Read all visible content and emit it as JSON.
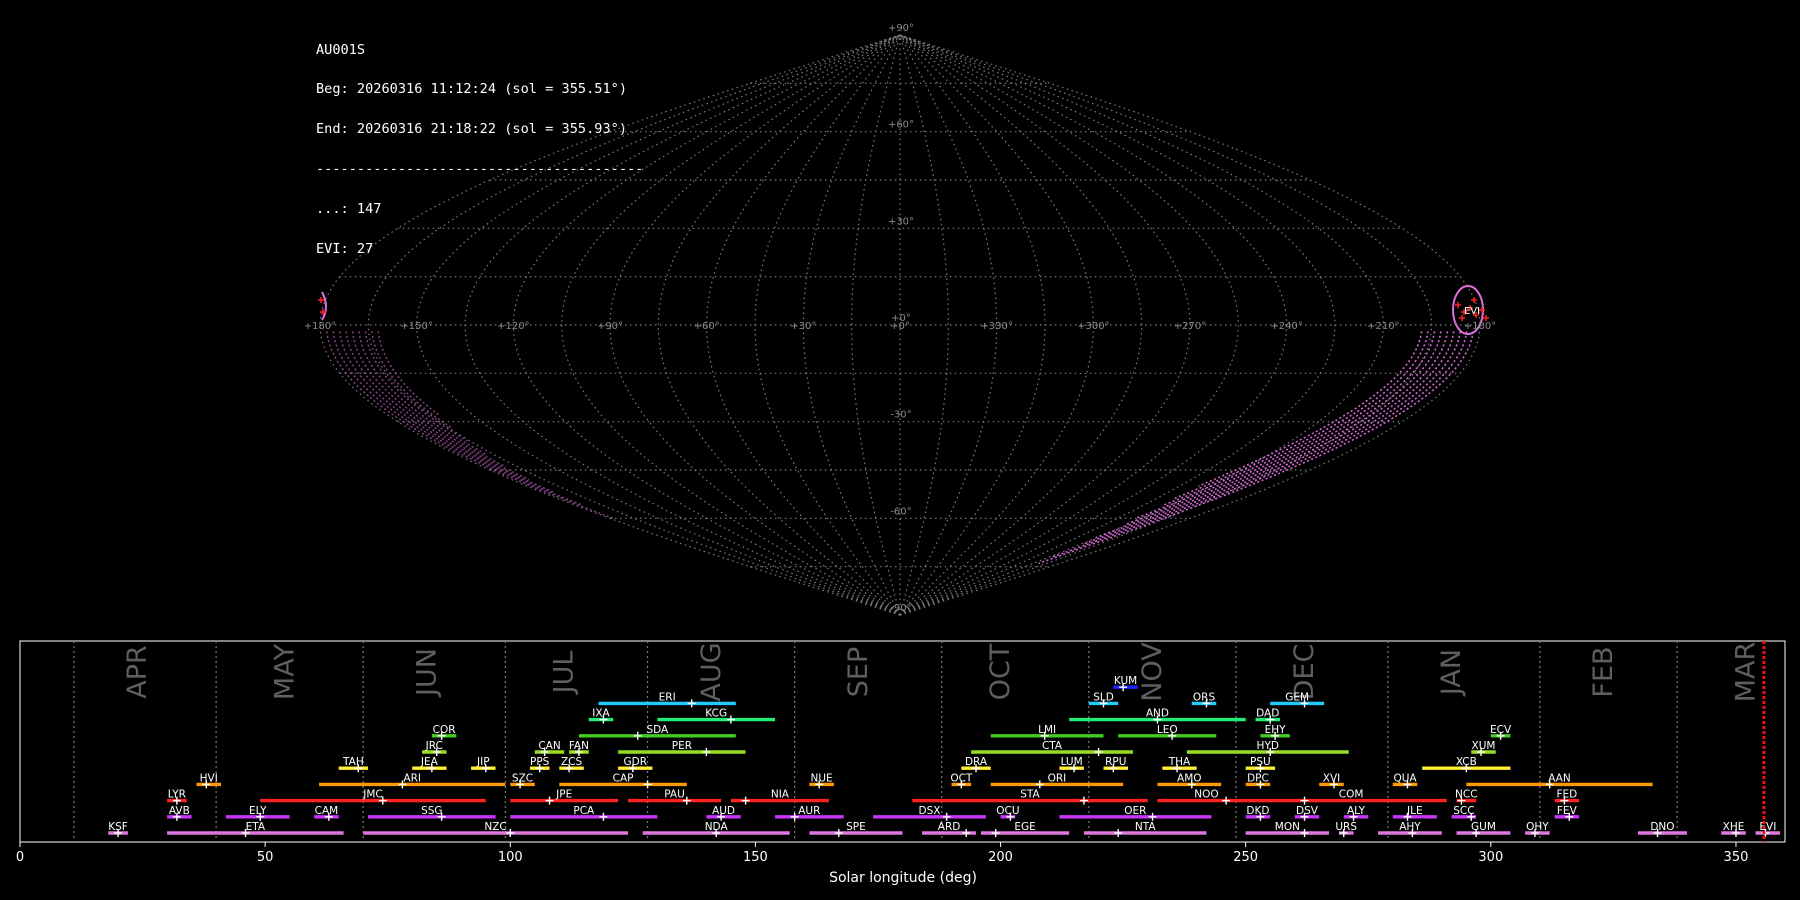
{
  "info": {
    "station": "AU001S",
    "beg": "Beg: 20260316 11:12:24 (sol = 355.51°)",
    "end": "End: 20260316 21:18:22 (sol = 355.93°)",
    "separator": "----------------------------------------",
    "count_dots": "...: 147",
    "count_evi": "EVI: 27"
  },
  "sky_map": {
    "projection": "sinusoidal (all-sky)",
    "lat_labels": [
      "+90°",
      "+60°",
      "+30°",
      "+0°",
      "-30°",
      "-60°",
      "-90°"
    ],
    "lon_labels": [
      "+180°",
      "+150°",
      "+120°",
      "+90°",
      "+60°",
      "+30°",
      "+0°",
      "+330°",
      "+300°",
      "+270°",
      "+240°",
      "+210°",
      "+180°"
    ],
    "highlight_label": "EVI",
    "colors": {
      "grid": "#8a8a8a",
      "tracks": "#dd6fdd",
      "radiants": "#ff2020"
    }
  },
  "chart_data": {
    "type": "bar",
    "subtype": "shower activity timeline (horizontal interval bars)",
    "xlabel": "Solar longitude (deg)",
    "xlim": [
      0,
      360
    ],
    "xticks": [
      0,
      50,
      100,
      150,
      200,
      250,
      300,
      350
    ],
    "month_labels": [
      "APR",
      "MAY",
      "JUN",
      "JUL",
      "AUG",
      "SEP",
      "OCT",
      "NOV",
      "DEC",
      "JAN",
      "FEB",
      "MAR"
    ],
    "month_positions": [
      24,
      54,
      83,
      111,
      141,
      171,
      200,
      231,
      262,
      292,
      323,
      352
    ],
    "month_boundaries": [
      11,
      40,
      70,
      99,
      128,
      158,
      188,
      218,
      248,
      279,
      310,
      338
    ],
    "current_sol": 355.7,
    "bar_colors": {
      "violet": "#cc33ff",
      "red": "#ff2222",
      "orange": "#ff9900",
      "yellow": "#ffee33",
      "lime": "#99dd22",
      "green": "#44cc22",
      "spring": "#22ee77",
      "cyan": "#22ccff",
      "blue": "#2222ff",
      "pink": "#dd77dd"
    },
    "showers": [
      {
        "code": "KSF",
        "start": 18,
        "end": 22,
        "peak": 20,
        "row": 0,
        "color": "pink"
      },
      {
        "code": "ETA",
        "start": 30,
        "end": 66,
        "peak": 46,
        "row": 0,
        "color": "pink"
      },
      {
        "code": "NZC",
        "start": 70,
        "end": 124,
        "peak": 100,
        "row": 0,
        "color": "pink"
      },
      {
        "code": "NDA",
        "start": 127,
        "end": 157,
        "peak": 142,
        "row": 0,
        "color": "pink"
      },
      {
        "code": "SPE",
        "start": 161,
        "end": 180,
        "peak": 167,
        "row": 0,
        "color": "pink"
      },
      {
        "code": "ARD",
        "start": 184,
        "end": 195,
        "peak": 193,
        "row": 0,
        "color": "pink"
      },
      {
        "code": "EGE",
        "start": 196,
        "end": 214,
        "peak": 199,
        "row": 0,
        "color": "pink"
      },
      {
        "code": "NTA",
        "start": 217,
        "end": 242,
        "peak": 224,
        "row": 0,
        "color": "pink"
      },
      {
        "code": "MON",
        "start": 250,
        "end": 267,
        "peak": 262,
        "row": 0,
        "color": "pink"
      },
      {
        "code": "URS",
        "start": 269,
        "end": 272,
        "peak": 270,
        "row": 0,
        "color": "pink"
      },
      {
        "code": "AHY",
        "start": 277,
        "end": 290,
        "peak": 284,
        "row": 0,
        "color": "pink"
      },
      {
        "code": "GUM",
        "start": 293,
        "end": 304,
        "peak": 297,
        "row": 0,
        "color": "pink"
      },
      {
        "code": "OHY",
        "start": 307,
        "end": 312,
        "peak": 309,
        "row": 0,
        "color": "pink"
      },
      {
        "code": "DNO",
        "start": 330,
        "end": 340,
        "peak": 334,
        "row": 0,
        "color": "pink"
      },
      {
        "code": "XHE",
        "start": 347,
        "end": 352,
        "peak": 350,
        "row": 0,
        "color": "pink"
      },
      {
        "code": "EVI",
        "start": 354,
        "end": 359,
        "peak": 356,
        "row": 0,
        "color": "pink"
      },
      {
        "code": "AVB",
        "start": 30,
        "end": 35,
        "peak": 32,
        "row": 1,
        "color": "violet"
      },
      {
        "code": "ELY",
        "start": 42,
        "end": 55,
        "peak": 49,
        "row": 1,
        "color": "violet"
      },
      {
        "code": "CAM",
        "start": 60,
        "end": 65,
        "peak": 63,
        "row": 1,
        "color": "violet"
      },
      {
        "code": "SSG",
        "start": 71,
        "end": 97,
        "peak": 86,
        "row": 1,
        "color": "violet"
      },
      {
        "code": "PCA",
        "start": 100,
        "end": 130,
        "peak": 119,
        "row": 1,
        "color": "violet"
      },
      {
        "code": "AUD",
        "start": 140,
        "end": 147,
        "peak": 143,
        "row": 1,
        "color": "violet"
      },
      {
        "code": "AUR",
        "start": 154,
        "end": 168,
        "peak": 158,
        "row": 1,
        "color": "violet"
      },
      {
        "code": "DSX",
        "start": 174,
        "end": 197,
        "peak": 189,
        "row": 1,
        "color": "violet"
      },
      {
        "code": "OCU",
        "start": 200,
        "end": 203,
        "peak": 202,
        "row": 1,
        "color": "violet"
      },
      {
        "code": "OER",
        "start": 212,
        "end": 243,
        "peak": 231,
        "row": 1,
        "color": "violet"
      },
      {
        "code": "DKD",
        "start": 250,
        "end": 255,
        "peak": 253,
        "row": 1,
        "color": "violet"
      },
      {
        "code": "DSV",
        "start": 260,
        "end": 265,
        "peak": 262,
        "row": 1,
        "color": "violet"
      },
      {
        "code": "ALY",
        "start": 270,
        "end": 275,
        "peak": 272,
        "row": 1,
        "color": "violet"
      },
      {
        "code": "JLE",
        "start": 280,
        "end": 289,
        "peak": 283,
        "row": 1,
        "color": "violet"
      },
      {
        "code": "SCC",
        "start": 292,
        "end": 297,
        "peak": 296,
        "row": 1,
        "color": "violet"
      },
      {
        "code": "FEV",
        "start": 313,
        "end": 318,
        "peak": 316,
        "row": 1,
        "color": "violet"
      },
      {
        "code": "LYR",
        "start": 30,
        "end": 34,
        "peak": 32,
        "row": 2,
        "color": "red"
      },
      {
        "code": "JMC",
        "start": 49,
        "end": 95,
        "peak": 74,
        "row": 2,
        "color": "red"
      },
      {
        "code": "JPE",
        "start": 100,
        "end": 122,
        "peak": 108,
        "row": 2,
        "color": "red"
      },
      {
        "code": "PAU",
        "start": 124,
        "end": 143,
        "peak": 136,
        "row": 2,
        "color": "red"
      },
      {
        "code": "NIA",
        "start": 145,
        "end": 165,
        "peak": 148,
        "row": 2,
        "color": "red"
      },
      {
        "code": "STA",
        "start": 182,
        "end": 230,
        "peak": 217,
        "row": 2,
        "color": "red"
      },
      {
        "code": "NOO",
        "start": 232,
        "end": 252,
        "peak": 246,
        "row": 2,
        "color": "red"
      },
      {
        "code": "COM",
        "start": 252,
        "end": 291,
        "peak": 262,
        "row": 2,
        "color": "red"
      },
      {
        "code": "NCC",
        "start": 293,
        "end": 297,
        "peak": 294,
        "row": 2,
        "color": "red"
      },
      {
        "code": "FED",
        "start": 313,
        "end": 318,
        "peak": 315,
        "row": 2,
        "color": "red"
      },
      {
        "code": "HVI",
        "start": 36,
        "end": 41,
        "peak": 38,
        "row": 3,
        "color": "orange"
      },
      {
        "code": "ARI",
        "start": 61,
        "end": 99,
        "peak": 78,
        "row": 3,
        "color": "orange"
      },
      {
        "code": "SZC",
        "start": 100,
        "end": 105,
        "peak": 102,
        "row": 3,
        "color": "orange"
      },
      {
        "code": "CAP",
        "start": 110,
        "end": 136,
        "peak": 128,
        "row": 3,
        "color": "orange"
      },
      {
        "code": "NUE",
        "start": 161,
        "end": 166,
        "peak": 163,
        "row": 3,
        "color": "orange"
      },
      {
        "code": "OCT",
        "start": 190,
        "end": 194,
        "peak": 192,
        "row": 3,
        "color": "orange"
      },
      {
        "code": "ORI",
        "start": 198,
        "end": 225,
        "peak": 208,
        "row": 3,
        "color": "orange"
      },
      {
        "code": "AMO",
        "start": 232,
        "end": 245,
        "peak": 239,
        "row": 3,
        "color": "orange"
      },
      {
        "code": "DPC",
        "start": 250,
        "end": 255,
        "peak": 253,
        "row": 3,
        "color": "orange"
      },
      {
        "code": "XVI",
        "start": 265,
        "end": 270,
        "peak": 268,
        "row": 3,
        "color": "orange"
      },
      {
        "code": "QUA",
        "start": 280,
        "end": 285,
        "peak": 283,
        "row": 3,
        "color": "orange"
      },
      {
        "code": "AAN",
        "start": 295,
        "end": 333,
        "peak": 312,
        "row": 3,
        "color": "orange"
      },
      {
        "code": "TAH",
        "start": 65,
        "end": 71,
        "peak": 69,
        "row": 4,
        "color": "yellow"
      },
      {
        "code": "JEA",
        "start": 80,
        "end": 87,
        "peak": 84,
        "row": 4,
        "color": "yellow"
      },
      {
        "code": "JIP",
        "start": 92,
        "end": 97,
        "peak": 95,
        "row": 4,
        "color": "yellow"
      },
      {
        "code": "PPS",
        "start": 104,
        "end": 108,
        "peak": 106,
        "row": 4,
        "color": "yellow"
      },
      {
        "code": "ZCS",
        "start": 110,
        "end": 115,
        "peak": 112,
        "row": 4,
        "color": "yellow"
      },
      {
        "code": "GDR",
        "start": 122,
        "end": 129,
        "peak": 125,
        "row": 4,
        "color": "yellow"
      },
      {
        "code": "DRA",
        "start": 192,
        "end": 198,
        "peak": 195,
        "row": 4,
        "color": "yellow"
      },
      {
        "code": "LUM",
        "start": 212,
        "end": 217,
        "peak": 215,
        "row": 4,
        "color": "yellow"
      },
      {
        "code": "RPU",
        "start": 221,
        "end": 226,
        "peak": 223,
        "row": 4,
        "color": "yellow"
      },
      {
        "code": "THA",
        "start": 233,
        "end": 240,
        "peak": 236,
        "row": 4,
        "color": "yellow"
      },
      {
        "code": "PSU",
        "start": 250,
        "end": 256,
        "peak": 253,
        "row": 4,
        "color": "yellow"
      },
      {
        "code": "XCB",
        "start": 286,
        "end": 304,
        "peak": 295,
        "row": 4,
        "color": "yellow"
      },
      {
        "code": "JRC",
        "start": 82,
        "end": 87,
        "peak": 85,
        "row": 5,
        "color": "lime"
      },
      {
        "code": "CAN",
        "start": 105,
        "end": 111,
        "peak": 107,
        "row": 5,
        "color": "lime"
      },
      {
        "code": "FAN",
        "start": 112,
        "end": 116,
        "peak": 114,
        "row": 5,
        "color": "lime"
      },
      {
        "code": "PER",
        "start": 122,
        "end": 148,
        "peak": 140,
        "row": 5,
        "color": "lime"
      },
      {
        "code": "CTA",
        "start": 194,
        "end": 227,
        "peak": 220,
        "row": 5,
        "color": "lime"
      },
      {
        "code": "HYD",
        "start": 238,
        "end": 271,
        "peak": 255,
        "row": 5,
        "color": "lime"
      },
      {
        "code": "XUM",
        "start": 296,
        "end": 301,
        "peak": 298,
        "row": 5,
        "color": "lime"
      },
      {
        "code": "COR",
        "start": 84,
        "end": 89,
        "peak": 86,
        "row": 6,
        "color": "green"
      },
      {
        "code": "SDA",
        "start": 114,
        "end": 146,
        "peak": 126,
        "row": 6,
        "color": "green"
      },
      {
        "code": "LMI",
        "start": 198,
        "end": 221,
        "peak": 209,
        "row": 6,
        "color": "green"
      },
      {
        "code": "LEO",
        "start": 224,
        "end": 244,
        "peak": 235,
        "row": 6,
        "color": "green"
      },
      {
        "code": "EHY",
        "start": 253,
        "end": 259,
        "peak": 256,
        "row": 6,
        "color": "green"
      },
      {
        "code": "ECV",
        "start": 300,
        "end": 304,
        "peak": 302,
        "row": 6,
        "color": "green"
      },
      {
        "code": "IXA",
        "start": 116,
        "end": 121,
        "peak": 119,
        "row": 7,
        "color": "spring"
      },
      {
        "code": "KCG",
        "start": 130,
        "end": 154,
        "peak": 145,
        "row": 7,
        "color": "spring"
      },
      {
        "code": "AND",
        "start": 214,
        "end": 250,
        "peak": 232,
        "row": 7,
        "color": "spring"
      },
      {
        "code": "DAD",
        "start": 252,
        "end": 257,
        "peak": 255,
        "row": 7,
        "color": "spring"
      },
      {
        "code": "ERI",
        "start": 118,
        "end": 146,
        "peak": 137,
        "row": 8,
        "color": "cyan"
      },
      {
        "code": "SLD",
        "start": 218,
        "end": 224,
        "peak": 221,
        "row": 8,
        "color": "cyan"
      },
      {
        "code": "ORS",
        "start": 239,
        "end": 244,
        "peak": 242,
        "row": 8,
        "color": "cyan"
      },
      {
        "code": "GEM",
        "start": 255,
        "end": 266,
        "peak": 262,
        "row": 8,
        "color": "cyan"
      },
      {
        "code": "KUM",
        "start": 223,
        "end": 228,
        "peak": 225,
        "row": 9,
        "color": "blue"
      }
    ]
  }
}
